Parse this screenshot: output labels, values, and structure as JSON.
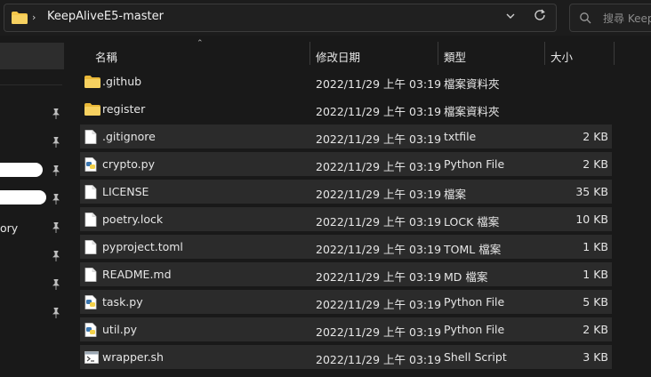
{
  "address": {
    "path": "KeepAliveE5-master",
    "chevron": "›",
    "dropdown_icon": "chevron-down-icon",
    "refresh_icon": "refresh-icon"
  },
  "search": {
    "placeholder": "搜尋 Keep"
  },
  "nav": {
    "partial_label": "ory"
  },
  "columns": {
    "name": "名稱",
    "date": "修改日期",
    "type": "類型",
    "size": "大小"
  },
  "files": [
    {
      "name": ".github",
      "date": "2022/11/29 上午 03:19",
      "type": "檔案資料夾",
      "size": "",
      "icon": "folder-icon"
    },
    {
      "name": "register",
      "date": "2022/11/29 上午 03:19",
      "type": "檔案資料夾",
      "size": "",
      "icon": "folder-icon"
    },
    {
      "name": ".gitignore",
      "date": "2022/11/29 上午 03:19",
      "type": "txtfile",
      "size": "2 KB",
      "icon": "file-icon"
    },
    {
      "name": "crypto.py",
      "date": "2022/11/29 上午 03:19",
      "type": "Python File",
      "size": "2 KB",
      "icon": "python-file-icon"
    },
    {
      "name": "LICENSE",
      "date": "2022/11/29 上午 03:19",
      "type": "檔案",
      "size": "35 KB",
      "icon": "file-icon"
    },
    {
      "name": "poetry.lock",
      "date": "2022/11/29 上午 03:19",
      "type": "LOCK 檔案",
      "size": "10 KB",
      "icon": "file-icon"
    },
    {
      "name": "pyproject.toml",
      "date": "2022/11/29 上午 03:19",
      "type": "TOML 檔案",
      "size": "1 KB",
      "icon": "file-icon"
    },
    {
      "name": "README.md",
      "date": "2022/11/29 上午 03:19",
      "type": "MD 檔案",
      "size": "1 KB",
      "icon": "file-icon"
    },
    {
      "name": "task.py",
      "date": "2022/11/29 上午 03:19",
      "type": "Python File",
      "size": "5 KB",
      "icon": "python-file-icon"
    },
    {
      "name": "util.py",
      "date": "2022/11/29 上午 03:19",
      "type": "Python File",
      "size": "2 KB",
      "icon": "python-file-icon"
    },
    {
      "name": "wrapper.sh",
      "date": "2022/11/29 上午 03:19",
      "type": "Shell Script",
      "size": "3 KB",
      "icon": "shell-script-icon"
    }
  ],
  "colors": {
    "background": "#191919",
    "row_highlight": "#2b2b2b",
    "folder": "#f4c64a",
    "python_blue": "#3a76b0",
    "python_yellow": "#f3d14a"
  }
}
